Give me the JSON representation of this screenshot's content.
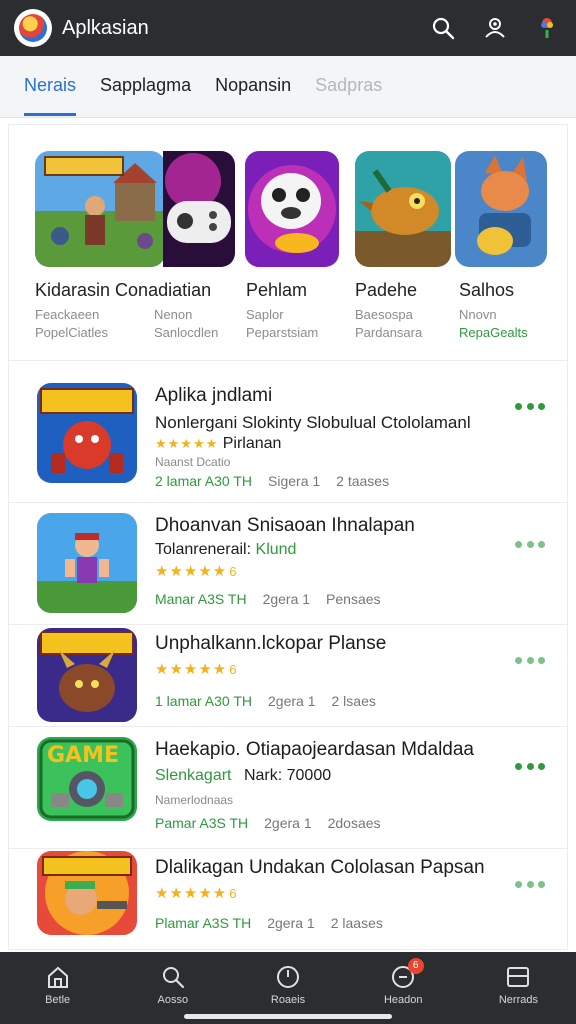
{
  "app": {
    "title": "Aplkasian"
  },
  "tabs": [
    {
      "label": "Nerais",
      "active": true
    },
    {
      "label": "Sapplagma",
      "active": false
    },
    {
      "label": "Nopansin",
      "active": false
    },
    {
      "label": "Sadpras",
      "active": false,
      "faded": true
    }
  ],
  "featured": [
    {
      "title": "Kidarasin Conadiatian",
      "sub1": "Feackaeen",
      "sub2": "PopelCiatles",
      "icon": "strategy-battle-art"
    },
    {
      "title": "",
      "sub1": "Nenon",
      "sub2": "Sanlocdlen",
      "icon": "gamepad-art"
    },
    {
      "title": "Pehlam",
      "sub1": "Saplor",
      "sub2": "Peparstsiam",
      "icon": "panda-mascot-art"
    },
    {
      "title": "Padehe",
      "sub1": "Baesospa",
      "sub2": "Pardansara",
      "icon": "dragon-art"
    },
    {
      "title": "Salhos",
      "sub1": "Nnovn",
      "sub2": "RepaGealts",
      "icon": "fox-warrior-art"
    }
  ],
  "list": [
    {
      "title": "Aplika jndlami",
      "line": "Nonlergani Slokinty Slobulual Ctololamanl",
      "rating_text": "Pirlanan",
      "rating": 4.5,
      "small": "Naanst Dcatio",
      "meta_left": "2 lamar A30 TH",
      "meta_mid": "Sigera 1",
      "meta_right": "2 taases",
      "icon": "dinamax-icon"
    },
    {
      "title": "Dhoanvan Snisaoan Ihnalapan",
      "line": "Tolanrenerail:",
      "line_green": "Klund",
      "rating": 5,
      "rating_num": "6",
      "meta_left": "Manar A3S TH",
      "meta_mid": "2gera 1",
      "meta_right": "Pensaes",
      "icon": "hero-boy-icon"
    },
    {
      "title": "Unphalkann.lckopar Planse",
      "rating": 5,
      "rating_num": "6",
      "meta_left": "1 lamar A30 TH",
      "meta_mid": "2gera 1",
      "meta_right": "2 lsaes",
      "icon": "dragon-monster-icon"
    },
    {
      "title": "Haekapio. Otiapaojeardasan Mdaldaa",
      "line": "Slenkagart",
      "line_gray": "Nark: 70000",
      "small": "Namerlodnaas",
      "meta_left": "Pamar A3S TH",
      "meta_mid": "2gera 1",
      "meta_right": "2dosaes",
      "icon": "game-badge-icon",
      "icon_text": "GAME"
    },
    {
      "title": "Dlalikagan Undakan Cololasan Papsan",
      "rating": 5,
      "rating_num": "6",
      "meta_left": "Plamar A3S TH",
      "meta_mid": "2gera 1",
      "meta_right": "2 laases",
      "icon": "shooter-icon"
    }
  ],
  "bottom_nav": [
    {
      "label": "Betle",
      "icon": "home-icon"
    },
    {
      "label": "Aosso",
      "icon": "search-icon"
    },
    {
      "label": "Roaeis",
      "icon": "clock-icon"
    },
    {
      "label": "Headon",
      "icon": "notification-icon",
      "badge": "6"
    },
    {
      "label": "Nerrads",
      "icon": "library-icon"
    }
  ],
  "colors": {
    "bar": "#2b2d30",
    "accent": "#2a6fd6",
    "green": "#2e9a3c",
    "star": "#f3b21c"
  }
}
